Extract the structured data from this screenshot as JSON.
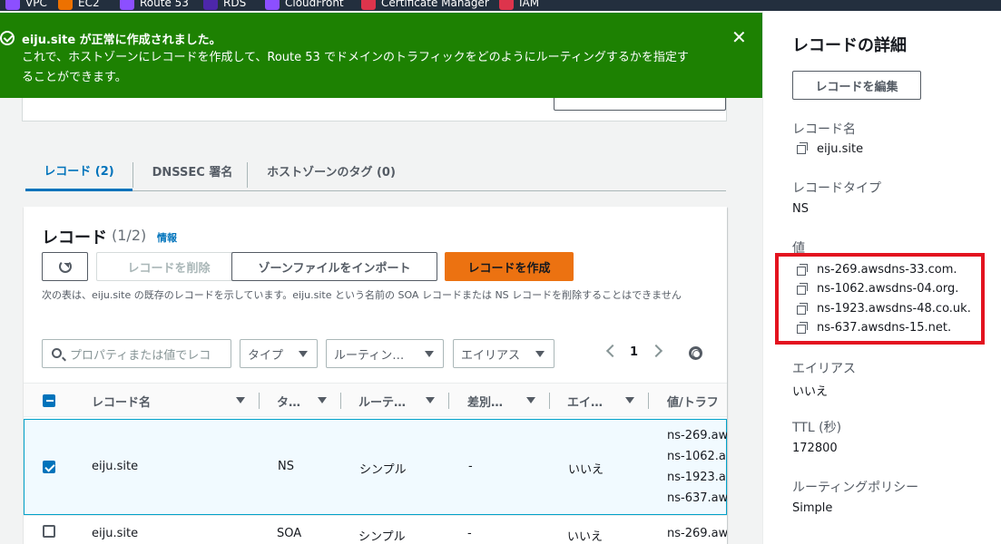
{
  "service_bar": {
    "items": [
      {
        "label": "VPC",
        "icon": "vpc-icon",
        "color": "#8c4fff"
      },
      {
        "label": "EC2",
        "icon": "ec2-icon",
        "color": "#ed7100"
      },
      {
        "label": "Route 53",
        "icon": "route53-icon",
        "color": "#8c4fff"
      },
      {
        "label": "RDS",
        "icon": "rds-icon",
        "color": "#4d27aa"
      },
      {
        "label": "CloudFront",
        "icon": "cloudfront-icon",
        "color": "#8c4fff"
      },
      {
        "label": "Certificate Manager",
        "icon": "acm-icon",
        "color": "#dd344c"
      },
      {
        "label": "IAM",
        "icon": "iam-icon",
        "color": "#dd344c"
      }
    ]
  },
  "flash": {
    "title": "eiju.site が正常に作成されました。",
    "message": "これで、ホストゾーンにレコードを作成して、Route 53 でドメインのトラフィックをどのようにルーティングするかを指定することができます。",
    "color": "#1d8102"
  },
  "tabs": [
    {
      "label": "レコード (2)"
    },
    {
      "label": "DNSSEC 署名"
    },
    {
      "label": "ホストゾーンのタグ (0)"
    }
  ],
  "records": {
    "title": "レコード",
    "count": "(1/2)",
    "info_link": "情報",
    "delete_label": "レコードを削除",
    "import_label": "ゾーンファイルをインポート",
    "create_label": "レコードを作成",
    "description": "次の表は、eiju.site の既存のレコードを示しています。eiju.site という名前の SOA レコードまたは NS レコードを削除することはできません",
    "search_placeholder": "プロパティまたは値でレコ",
    "filter_type": "タイプ",
    "filter_routing": "ルーティン…",
    "filter_alias": "エイリアス",
    "page": "1",
    "columns": [
      "レコード名",
      "タ…",
      "ルーテ…",
      "差別…",
      "エイ…",
      "値/トラフ"
    ],
    "rows": [
      {
        "name": "eiju.site",
        "type": "NS",
        "routing": "シンプル",
        "diff": "-",
        "alias": "いいえ",
        "values": [
          "ns-269.aw",
          "ns-1062.a",
          "ns-1923.a",
          "ns-637.aw"
        ]
      },
      {
        "name": "eiju.site",
        "type": "SOA",
        "routing": "シンプル",
        "diff": "-",
        "alias": "いいえ",
        "values": [
          "ns-269.aw"
        ]
      }
    ]
  },
  "panel": {
    "title": "レコードの詳細",
    "edit_label": "レコードを編集",
    "name_label": "レコード名",
    "name_value": "eiju.site",
    "type_label": "レコードタイプ",
    "type_value": "NS",
    "value_label": "値",
    "values": [
      "ns-269.awsdns-33.com.",
      "ns-1062.awsdns-04.org.",
      "ns-1923.awsdns-48.co.uk.",
      "ns-637.awsdns-15.net."
    ],
    "alias_label": "エイリアス",
    "alias_value": "いいえ",
    "ttl_label": "TTL (秒)",
    "ttl_value": "172800",
    "policy_label": "ルーティングポリシー",
    "policy_value": "Simple"
  }
}
